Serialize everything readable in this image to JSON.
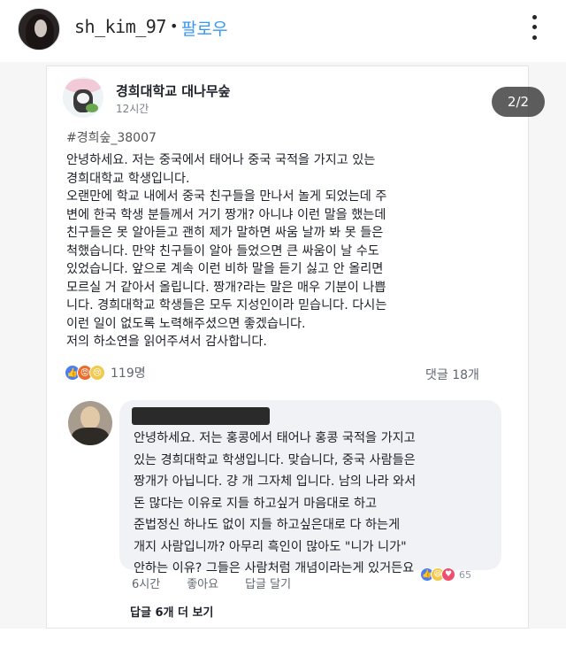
{
  "header": {
    "username": "sh_kim_97",
    "separator": "•",
    "follow_label": "팔로우",
    "more_icon": "more-vertical-icon"
  },
  "carousel": {
    "counter": "2/2"
  },
  "fb_post": {
    "page_name": "경희대학교 대나무숲",
    "time": "12시간",
    "hashtag": "#경희숲_38007",
    "lines": [
      "안녕하세요. 저는 중국에서 태어나 중국 국적을 가지고 있는",
      "경희대학교 학생입니다.",
      "오랜만에 학교 내에서 중국 친구들을 만나서 놀게 되었는데 주",
      "변에 한국 학생 분들께서 거기 짱개? 아니냐 이런 말을 했는데",
      "친구들은 못 알아듣고 괜히 제가 말하면 싸움 날까 봐 못 들은",
      "척했습니다. 만약 친구들이 알아 들었으면 큰 싸움이 날 수도",
      "있었습니다. 앞으로 계속 이런 비하 말을 듣기 싫고 안 올리면",
      "모르실 거 같아서 올립니다. 짱개?라는 말은 매우 기분이 나쁩",
      "니다. 경희대학교 학생들은 모두 지성인이라 믿습니다. 다시는",
      "이런 일이 없도록 노력해주셨으면 좋겠습니다.",
      "저의 하소연을 읽어주셔서 감사합니다."
    ],
    "reaction_count": "119명",
    "comment_count": "댓글 18개"
  },
  "comment": {
    "lines": [
      "안녕하세요. 저는 홍콩에서 태어나 홍콩 국적을 가지고",
      "있는 경희대학교 학생입니다. 맞습니다, 중국 사람들은",
      "짱개가 아닙니다. 걍 개 그자체 입니다. 남의 나라 와서",
      "돈 많다는 이유로 지들 하고싶거 마음대로 하고",
      "준법정신 하나도 없이 지들 하고싶은대로 다 하는게",
      "개지 사람입니까? 아무리 흑인이 많아도 \"니가 니가\"",
      "안하는 이유? 그들은 사람처럼 개념이라는게 있거든요"
    ],
    "time": "6시간",
    "like_label": "좋아요",
    "reply_label": "답글 달기",
    "reaction_count": "65",
    "more_replies": "답글 6개 더 보기"
  }
}
